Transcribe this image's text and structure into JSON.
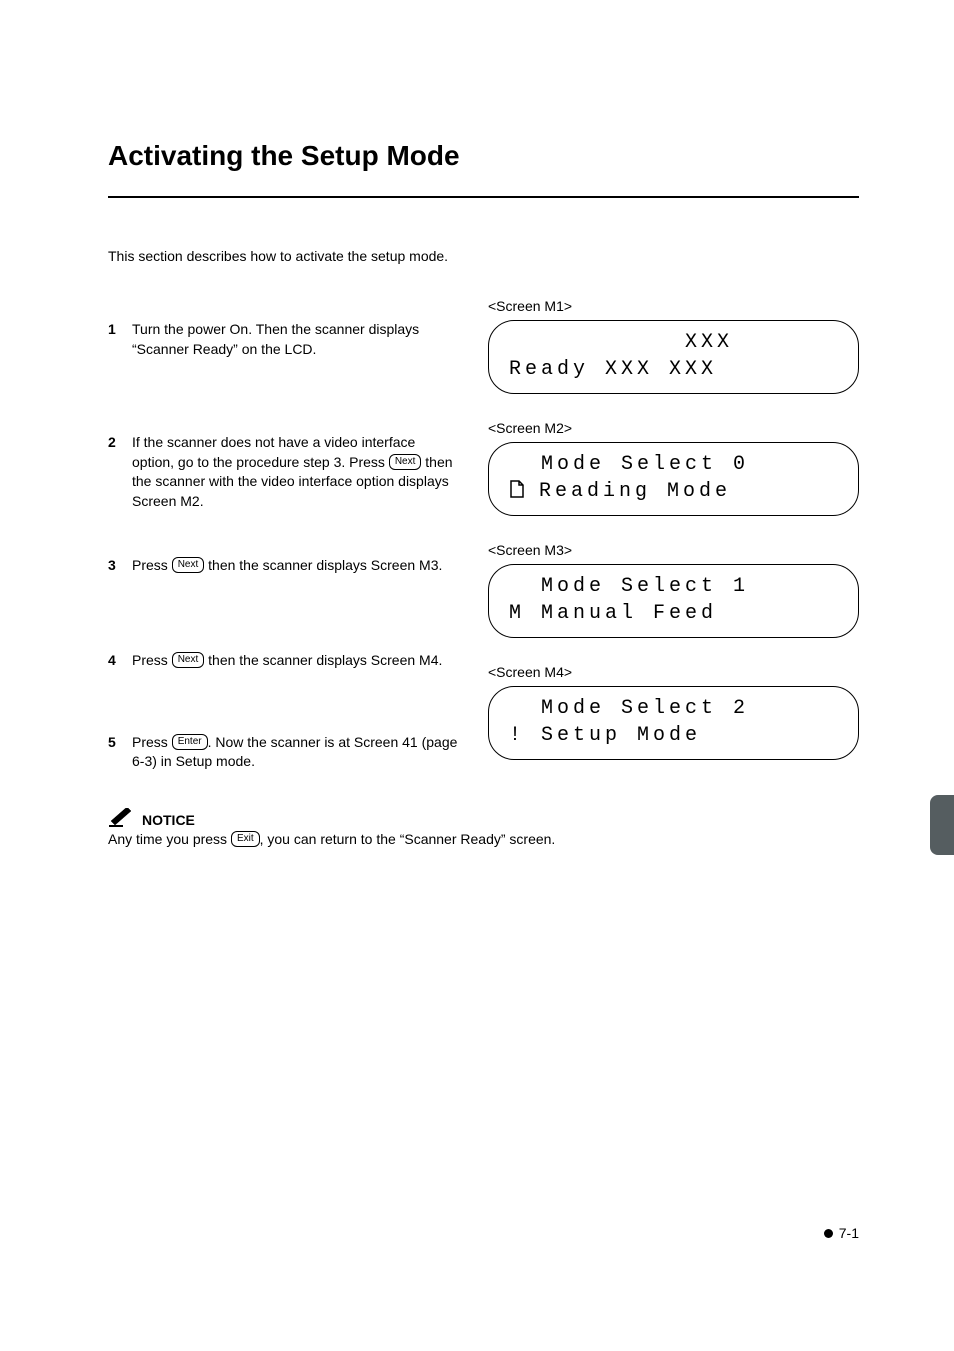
{
  "title": "Activating the Setup Mode",
  "intro": "This section describes how to activate the setup mode.",
  "keys": {
    "next": "Next",
    "enter": "Enter",
    "exit": "Exit"
  },
  "steps": {
    "s1": {
      "num": "1",
      "text": "Turn the power On. Then the scanner displays “Scanner Ready” on the LCD."
    },
    "s2": {
      "num": "2",
      "text_a": "If the scanner does not have a video interface option, go to the procedure step 3. Press ",
      "text_b": " then the scanner with the video interface option displays Screen M2."
    },
    "s3": {
      "num": "3",
      "text_a": "Press ",
      "text_b": " then the scanner displays Screen M3."
    },
    "s4": {
      "num": "4",
      "text_a": "Press ",
      "text_b": " then the scanner displays Screen M4."
    },
    "s5": {
      "num": "5",
      "text_a": "Press ",
      "text_b": ". Now the scanner is at Screen 41 (page 6-3) in Setup mode."
    }
  },
  "screens": {
    "m1": {
      "label": "<Screen M1>",
      "line1": "           XXX",
      "line2": "Ready XXX XXX"
    },
    "m2": {
      "label": "<Screen M2>",
      "line1": "  Mode Select 0",
      "icon": "↵",
      "line2_text": "Reading Mode"
    },
    "m3": {
      "label": "<Screen M3>",
      "line1": "  Mode Select 1",
      "line2": "M Manual Feed"
    },
    "m4": {
      "label": "<Screen M4>",
      "line1": "  Mode Select 2",
      "line2": "! Setup Mode"
    }
  },
  "notice": {
    "label": "NOTICE",
    "text_a": "Any time you press ",
    "text_b": ", you can return to the “Scanner Ready” screen."
  },
  "page_number": "7-1"
}
